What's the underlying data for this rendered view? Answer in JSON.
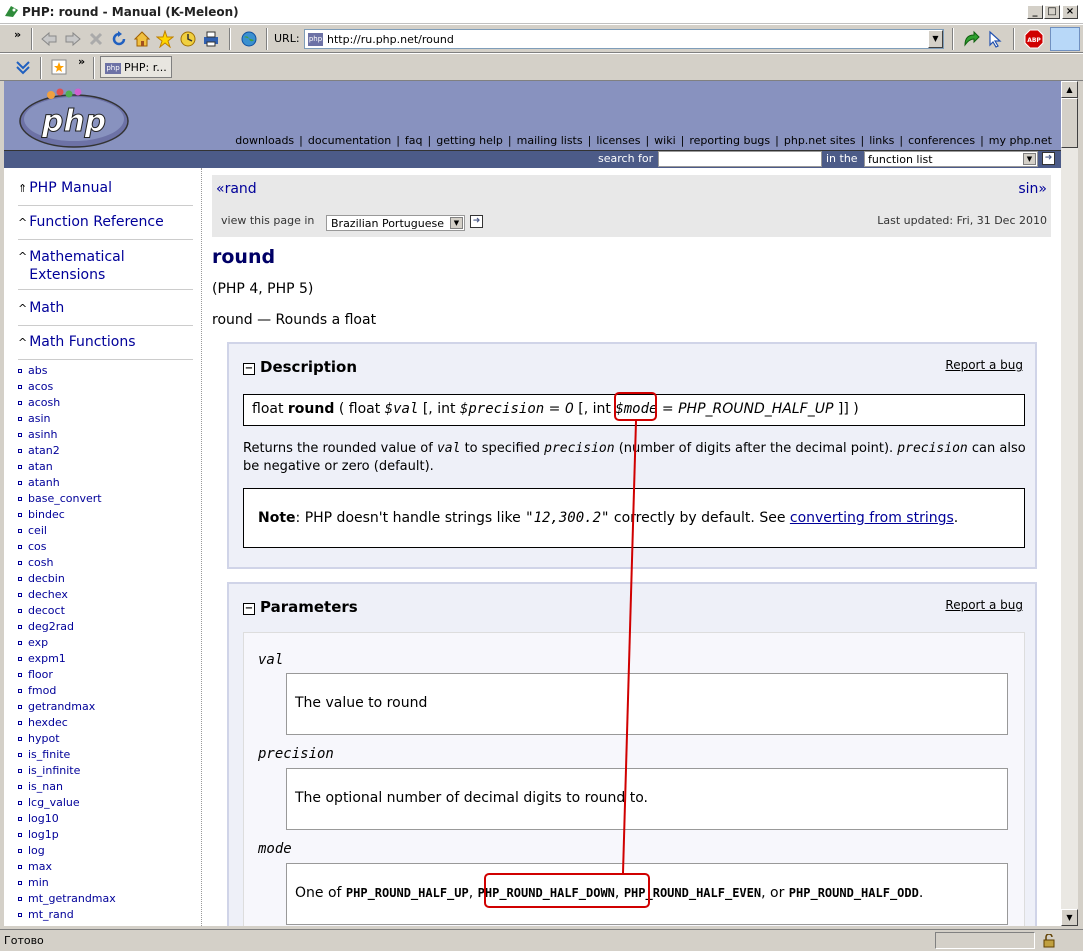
{
  "window": {
    "title": "PHP: round - Manual (K-Meleon)"
  },
  "toolbar": {
    "url_label": "URL:",
    "url": "http://ru.php.net/round",
    "tab_label": "PHP: r...",
    "favicon": "php"
  },
  "status": {
    "text": "Готово"
  },
  "header": {
    "nav": [
      "downloads",
      "documentation",
      "faq",
      "getting help",
      "mailing lists",
      "licenses",
      "wiki",
      "reporting bugs",
      "php.net sites",
      "links",
      "conferences",
      "my php.net"
    ],
    "search_label": "search for",
    "in_the_label": "in the",
    "search_scope": "function list"
  },
  "sidebar": {
    "headings": [
      "PHP Manual",
      "Function Reference",
      "Mathematical Extensions",
      "Math",
      "Math Functions"
    ],
    "functions": [
      "abs",
      "acos",
      "acosh",
      "asin",
      "asinh",
      "atan2",
      "atan",
      "atanh",
      "base_convert",
      "bindec",
      "ceil",
      "cos",
      "cosh",
      "decbin",
      "dechex",
      "decoct",
      "deg2rad",
      "exp",
      "expm1",
      "floor",
      "fmod",
      "getrandmax",
      "hexdec",
      "hypot",
      "is_finite",
      "is_infinite",
      "is_nan",
      "lcg_value",
      "log10",
      "log1p",
      "log",
      "max",
      "min",
      "mt_getrandmax",
      "mt_rand"
    ]
  },
  "pagenav": {
    "prev": "rand",
    "next": "sin",
    "view_label": "view this page in",
    "language": "Brazilian Portuguese",
    "updated": "Last updated: Fri, 31 Dec 2010"
  },
  "func": {
    "name": "round",
    "versions": "(PHP 4, PHP 5)",
    "purpose": "round — Rounds a float"
  },
  "description": {
    "heading": "Description",
    "report": "Report a bug",
    "sig_return": "float",
    "sig_name": "round",
    "sig_p1_type": "float",
    "sig_p1": "$val",
    "sig_p2_type": "int",
    "sig_p2": "$precision",
    "sig_p2_default": "0",
    "sig_p3_type": "int",
    "sig_p3": "$mode",
    "sig_p3_default": "PHP_ROUND_HALF_UP",
    "text_a": "Returns the rounded value of",
    "text_val": "val",
    "text_b": "to specified",
    "text_prec": "precision",
    "text_c": "(number of digits after the decimal point).",
    "text_prec2": "precision",
    "text_d": "can also be negative or zero (default).",
    "note_label": "Note",
    "note_text_a": ": PHP doesn't handle strings like",
    "note_example": "\"12,300.2\"",
    "note_text_b": "correctly by default. See",
    "note_link": "converting from strings",
    "note_end": "."
  },
  "parameters": {
    "heading": "Parameters",
    "report": "Report a bug",
    "items": [
      {
        "name": "val",
        "desc": "The value to round"
      },
      {
        "name": "precision",
        "desc": "The optional number of decimal digits to round to."
      },
      {
        "name": "mode",
        "desc_a": "One of",
        "c1": "PHP_ROUND_HALF_UP",
        "c2": "PHP_ROUND_HALF_DOWN",
        "c3": "PHP_ROUND_HALF_EVEN",
        "or": ", or",
        "c4": "PHP_ROUND_HALF_ODD"
      }
    ]
  },
  "colors": {
    "annotation": "#d00000",
    "php_header": "#8892bf",
    "search_bar": "#4c5b88",
    "link": "#000099"
  }
}
